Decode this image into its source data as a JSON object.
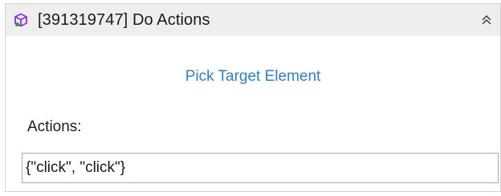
{
  "activity": {
    "title": "[391319747] Do Actions",
    "icon": "package-icon",
    "collapse_icon": "double-chevron-up-icon"
  },
  "body": {
    "pick_target_label": "Pick Target Element",
    "actions_label": "Actions:",
    "actions_value": "{\"click\", \"click\"}"
  },
  "colors": {
    "header_bg": "#eeeeee",
    "link": "#2e7fc9",
    "icon_purple": "#8a2be2",
    "border": "#d3d3d3"
  }
}
